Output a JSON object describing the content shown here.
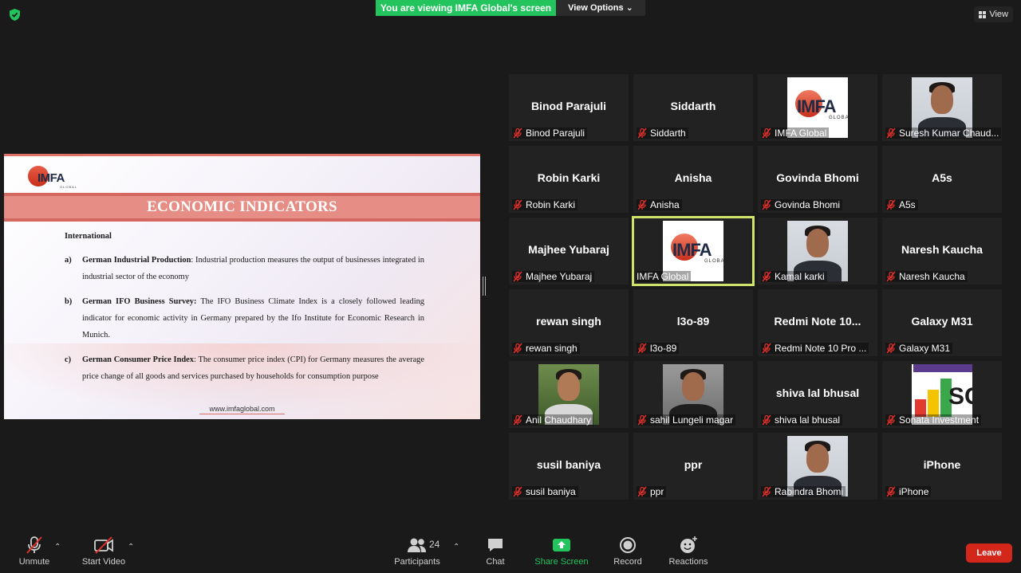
{
  "top_bar": {
    "viewing_banner": "You are viewing IMFA Global's screen",
    "view_options": "View Options",
    "view_button": "View"
  },
  "slide": {
    "logo_text": "IMFA",
    "logo_sub": "GLOBAL",
    "title": "ECONOMIC INDICATORS",
    "section": "International",
    "items": [
      {
        "letter": "a)",
        "term": "German Industrial Production",
        "sep": ":",
        "text": " Industrial production measures the output of businesses integrated in industrial sector of the economy"
      },
      {
        "letter": "b)",
        "term": "German IFO Business Survey:",
        "sep": "",
        "text": " The IFO Business Climate Index is a closely followed leading indicator for economic activity in Germany prepared by the Ifo Institute for Economic Research in Munich."
      },
      {
        "letter": "c)",
        "term": "German Consumer Price Index",
        "sep": ":",
        "text": " The consumer price index (CPI) for Germany measures the average price change of all goods and services purchased by households for consumption purpose"
      }
    ],
    "footer": "www.imfaglobal.com"
  },
  "participants": [
    {
      "center": "Binod Parajuli",
      "label": "Binod Parajuli",
      "pic": ""
    },
    {
      "center": "Siddarth",
      "label": "Siddarth",
      "pic": ""
    },
    {
      "center": "",
      "label": "IMFA Global",
      "pic": "imfa"
    },
    {
      "center": "",
      "label": "Suresh Kumar Chaud...",
      "pic": "face"
    },
    {
      "center": "Robin Karki",
      "label": "Robin Karki",
      "pic": ""
    },
    {
      "center": "Anisha",
      "label": "Anisha",
      "pic": ""
    },
    {
      "center": "Govinda Bhomi",
      "label": "Govinda Bhomi",
      "pic": ""
    },
    {
      "center": "A5s",
      "label": "A5s",
      "pic": ""
    },
    {
      "center": "Majhee Yubaraj",
      "label": "Majhee Yubaraj",
      "pic": ""
    },
    {
      "center": "",
      "label": "IMFA Global",
      "pic": "imfa",
      "active": true,
      "unmuted": true
    },
    {
      "center": "",
      "label": "Kamal karki",
      "pic": "face"
    },
    {
      "center": "Naresh Kaucha",
      "label": "Naresh Kaucha",
      "pic": ""
    },
    {
      "center": "rewan singh",
      "label": "rewan singh",
      "pic": ""
    },
    {
      "center": "l3o-89",
      "label": "l3o-89",
      "pic": ""
    },
    {
      "center": "Redmi Note 10...",
      "label": "Redmi Note 10 Pro ...",
      "pic": ""
    },
    {
      "center": "Galaxy M31",
      "label": "Galaxy M31",
      "pic": ""
    },
    {
      "center": "",
      "label": "Anil Chaudhary",
      "pic": "out"
    },
    {
      "center": "",
      "label": "sahil Lungeli  magar",
      "pic": "gray"
    },
    {
      "center": "shiva lal bhusal",
      "label": "shiva lal bhusal",
      "pic": ""
    },
    {
      "center": "",
      "label": "Sonata Investment",
      "pic": "sonata"
    },
    {
      "center": "susil baniya",
      "label": "susil baniya",
      "pic": ""
    },
    {
      "center": "ppr",
      "label": "ppr",
      "pic": ""
    },
    {
      "center": "",
      "label": "Rabindra Bhomi",
      "pic": "face"
    },
    {
      "center": "iPhone",
      "label": "iPhone",
      "pic": ""
    }
  ],
  "toolbar": {
    "unmute": "Unmute",
    "start_video": "Start Video",
    "participants": "Participants",
    "participants_count": "24",
    "chat": "Chat",
    "share_screen": "Share Screen",
    "record": "Record",
    "reactions": "Reactions",
    "leave": "Leave"
  },
  "colors": {
    "share_green": "#23c45e",
    "leave_red": "#d4271c",
    "active_speaker": "#cde36a",
    "slide_band": "#e68e86"
  }
}
